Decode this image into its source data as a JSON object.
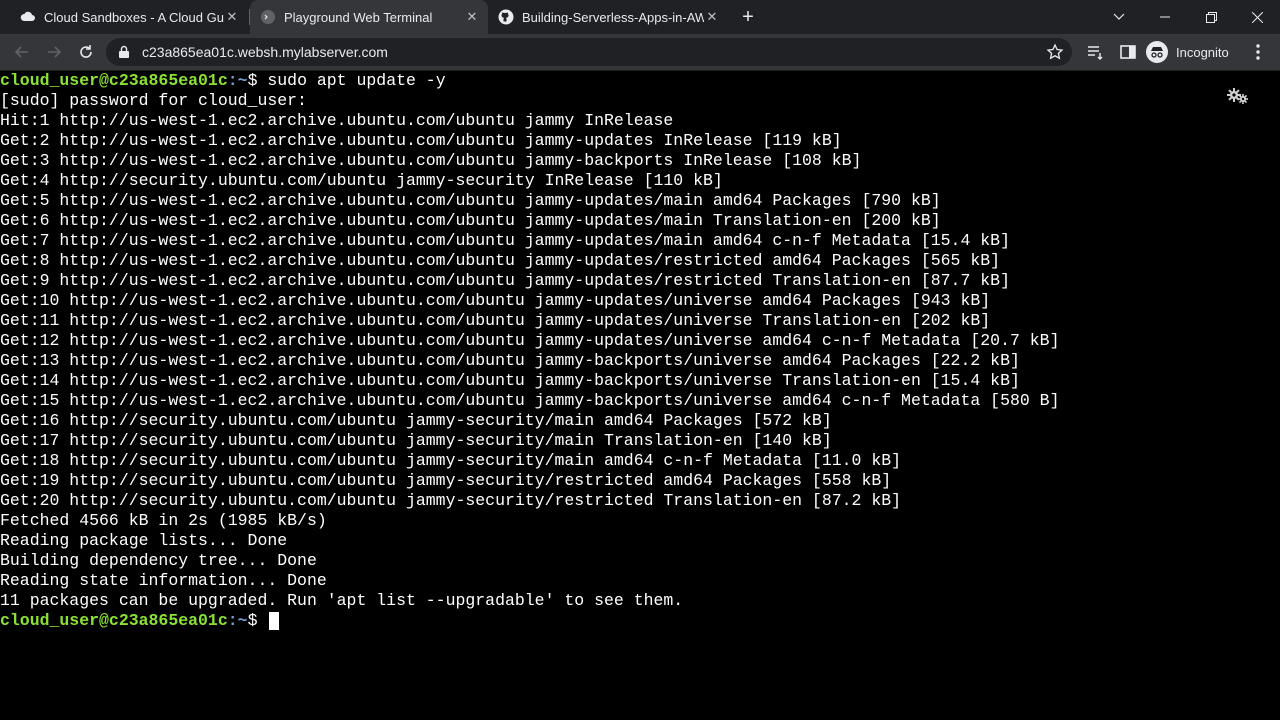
{
  "browser": {
    "tabs": [
      {
        "title": "Cloud Sandboxes - A Cloud Guru",
        "active": false
      },
      {
        "title": "Playground Web Terminal",
        "active": true
      },
      {
        "title": "Building-Serverless-Apps-in-AWS",
        "active": false
      }
    ],
    "url": "c23a865ea01c.websh.mylabserver.com",
    "profile_label": "Incognito"
  },
  "terminal": {
    "prompt_user": "cloud_user@c23a865ea01c",
    "prompt_path": ":~",
    "prompt_symbol": "$ ",
    "command": "sudo apt update -y",
    "output": [
      "[sudo] password for cloud_user:",
      "Hit:1 http://us-west-1.ec2.archive.ubuntu.com/ubuntu jammy InRelease",
      "Get:2 http://us-west-1.ec2.archive.ubuntu.com/ubuntu jammy-updates InRelease [119 kB]",
      "Get:3 http://us-west-1.ec2.archive.ubuntu.com/ubuntu jammy-backports InRelease [108 kB]",
      "Get:4 http://security.ubuntu.com/ubuntu jammy-security InRelease [110 kB]",
      "Get:5 http://us-west-1.ec2.archive.ubuntu.com/ubuntu jammy-updates/main amd64 Packages [790 kB]",
      "Get:6 http://us-west-1.ec2.archive.ubuntu.com/ubuntu jammy-updates/main Translation-en [200 kB]",
      "Get:7 http://us-west-1.ec2.archive.ubuntu.com/ubuntu jammy-updates/main amd64 c-n-f Metadata [15.4 kB]",
      "Get:8 http://us-west-1.ec2.archive.ubuntu.com/ubuntu jammy-updates/restricted amd64 Packages [565 kB]",
      "Get:9 http://us-west-1.ec2.archive.ubuntu.com/ubuntu jammy-updates/restricted Translation-en [87.7 kB]",
      "Get:10 http://us-west-1.ec2.archive.ubuntu.com/ubuntu jammy-updates/universe amd64 Packages [943 kB]",
      "Get:11 http://us-west-1.ec2.archive.ubuntu.com/ubuntu jammy-updates/universe Translation-en [202 kB]",
      "Get:12 http://us-west-1.ec2.archive.ubuntu.com/ubuntu jammy-updates/universe amd64 c-n-f Metadata [20.7 kB]",
      "Get:13 http://us-west-1.ec2.archive.ubuntu.com/ubuntu jammy-backports/universe amd64 Packages [22.2 kB]",
      "Get:14 http://us-west-1.ec2.archive.ubuntu.com/ubuntu jammy-backports/universe Translation-en [15.4 kB]",
      "Get:15 http://us-west-1.ec2.archive.ubuntu.com/ubuntu jammy-backports/universe amd64 c-n-f Metadata [580 B]",
      "Get:16 http://security.ubuntu.com/ubuntu jammy-security/main amd64 Packages [572 kB]",
      "Get:17 http://security.ubuntu.com/ubuntu jammy-security/main Translation-en [140 kB]",
      "Get:18 http://security.ubuntu.com/ubuntu jammy-security/main amd64 c-n-f Metadata [11.0 kB]",
      "Get:19 http://security.ubuntu.com/ubuntu jammy-security/restricted amd64 Packages [558 kB]",
      "Get:20 http://security.ubuntu.com/ubuntu jammy-security/restricted Translation-en [87.2 kB]",
      "Fetched 4566 kB in 2s (1985 kB/s)",
      "Reading package lists... Done",
      "Building dependency tree... Done",
      "Reading state information... Done",
      "11 packages can be upgraded. Run 'apt list --upgradable' to see them."
    ]
  }
}
